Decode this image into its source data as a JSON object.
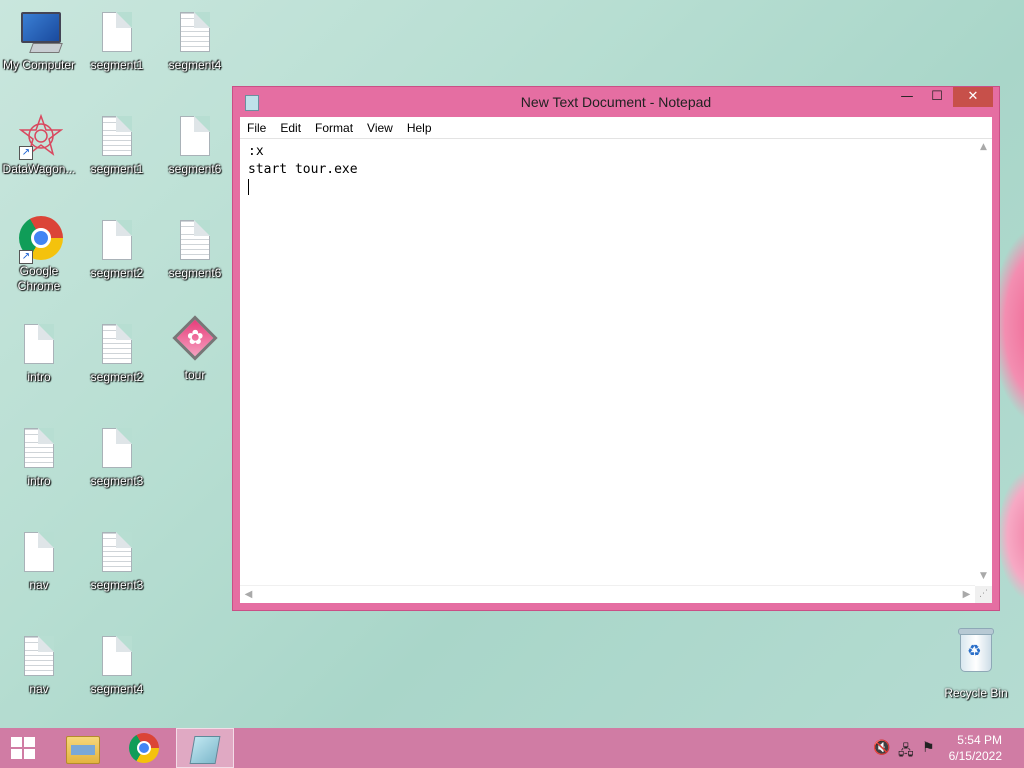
{
  "desktop": {
    "icons": [
      {
        "label": "My Computer"
      },
      {
        "label": "segment1"
      },
      {
        "label": "segment4"
      },
      {
        "label": "DataWagon..."
      },
      {
        "label": "segment1"
      },
      {
        "label": "segment6"
      },
      {
        "label": "Google Chrome"
      },
      {
        "label": "segment2"
      },
      {
        "label": "segment6"
      },
      {
        "label": "intro"
      },
      {
        "label": "segment2"
      },
      {
        "label": "tour"
      },
      {
        "label": "intro"
      },
      {
        "label": "segment3"
      },
      {
        "label": "nav"
      },
      {
        "label": "segment3"
      },
      {
        "label": "nav"
      },
      {
        "label": "segment4"
      }
    ],
    "recycle_bin": "Recycle Bin"
  },
  "notepad": {
    "title": "New Text Document - Notepad",
    "menu": [
      "File",
      "Edit",
      "Format",
      "View",
      "Help"
    ],
    "content": ":x\nstart tour.exe\n"
  },
  "taskbar": {
    "time": "5:54 PM",
    "date": "6/15/2022"
  }
}
